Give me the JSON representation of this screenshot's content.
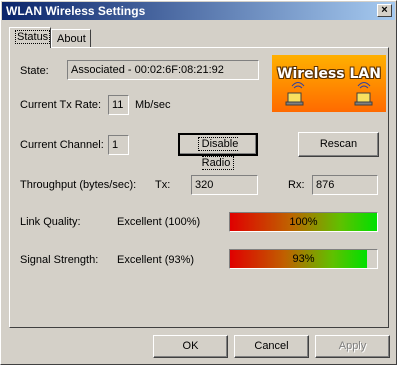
{
  "window": {
    "title": "WLAN Wireless Settings",
    "close_symbol": "×"
  },
  "tabs": [
    {
      "label": "Status",
      "active": true
    },
    {
      "label": "About",
      "active": false
    }
  ],
  "status": {
    "state_label": "State:",
    "state_value": "Associated - 00:02:6F:08:21:92",
    "tx_rate_label": "Current Tx Rate:",
    "tx_rate_value": "11",
    "tx_rate_unit": "Mb/sec",
    "channel_label": "Current Channel:",
    "channel_value": "1",
    "disable_radio_label": "Disable Radio",
    "rescan_label": "Rescan",
    "throughput_label": "Throughput (bytes/sec):",
    "tx_label": "Tx:",
    "tx_value": "320",
    "rx_label": "Rx:",
    "rx_value": "876",
    "link_quality_label": "Link Quality:",
    "link_quality_value": "Excellent (100%)",
    "link_quality_percent": 100,
    "link_quality_bar_text": "100%",
    "signal_strength_label": "Signal Strength:",
    "signal_strength_value": "Excellent (93%)",
    "signal_strength_percent": 93,
    "signal_strength_bar_text": "93%"
  },
  "logo": {
    "text": "Wireless LAN",
    "icon": "laptop-wireless-icon"
  },
  "buttons": {
    "ok": "OK",
    "cancel": "Cancel",
    "apply": "Apply"
  }
}
